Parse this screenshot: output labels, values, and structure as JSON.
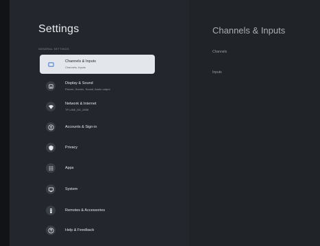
{
  "header": {
    "title": "Settings"
  },
  "section": {
    "label": "GENERAL SETTINGS"
  },
  "menu": {
    "items": [
      {
        "label": "Channels & Inputs",
        "sub": "Channels, Inputs"
      },
      {
        "label": "Display & Sound",
        "sub": "Picture, Screen, Sound, Audio output"
      },
      {
        "label": "Network & Internet",
        "sub": "TP-LINK_5G_2898"
      },
      {
        "label": "Accounts & Sign-in"
      },
      {
        "label": "Privacy"
      },
      {
        "label": "Apps"
      },
      {
        "label": "System"
      },
      {
        "label": "Remotes & Accessories"
      },
      {
        "label": "Help & Feedback"
      }
    ]
  },
  "detail": {
    "title": "Channels & Inputs",
    "items": [
      {
        "label": "Channels"
      },
      {
        "label": "Inputs"
      }
    ]
  },
  "colors": {
    "selected_bg": "#e3e6ea",
    "left_bg": "#23262c",
    "right_bg": "#202327"
  }
}
